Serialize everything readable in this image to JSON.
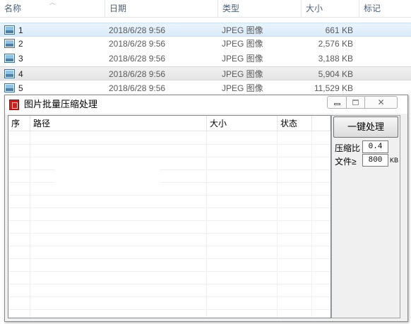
{
  "explorer": {
    "columns": {
      "name": "名称",
      "date": "日期",
      "type": "类型",
      "size": "大小",
      "tags": "标记"
    },
    "files": [
      {
        "name": "1",
        "date": "2018/6/28 9:56",
        "type": "JPEG 图像",
        "size": "661 KB"
      },
      {
        "name": "2",
        "date": "2018/6/28 9:56",
        "type": "JPEG 图像",
        "size": "2,576 KB"
      },
      {
        "name": "3",
        "date": "2018/6/28 9:56",
        "type": "JPEG 图像",
        "size": "3,188 KB"
      },
      {
        "name": "4",
        "date": "2018/6/28 9:56",
        "type": "JPEG 图像",
        "size": "5,904 KB"
      },
      {
        "name": "5",
        "date": "2018/6/28 9:56",
        "type": "JPEG 图像",
        "size": "11,529 KB"
      }
    ]
  },
  "app": {
    "title": "图片批量压缩处理",
    "table": {
      "headers": {
        "index": "序",
        "path": "路径",
        "size": "大小",
        "status": "状态"
      }
    },
    "actions": {
      "process_label": "一键处理"
    },
    "settings": {
      "ratio_label": "压缩比",
      "ratio_value": "0.4",
      "file_label": "文件≥",
      "file_value": "800",
      "file_unit": "KB"
    }
  }
}
